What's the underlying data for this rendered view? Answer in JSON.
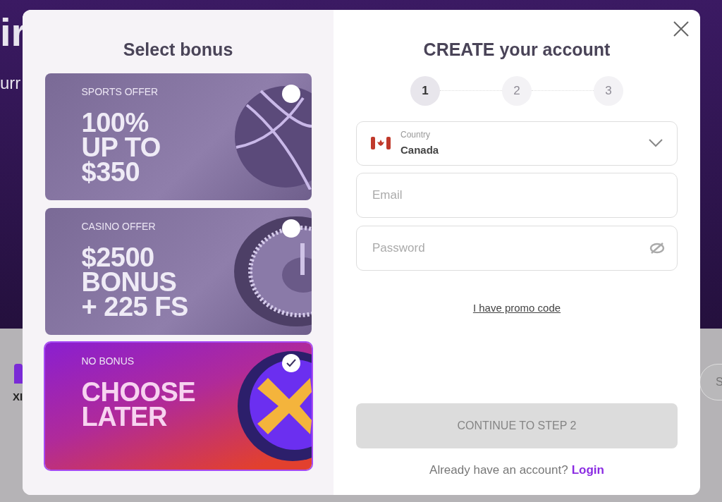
{
  "background": {
    "hero_fragments": [
      "ir",
      "urr"
    ],
    "tile_fragment": "XI",
    "pill_fragment": "S"
  },
  "bonus_panel": {
    "title": "Select bonus",
    "offers": [
      {
        "kind": "sports",
        "category": "SPORTS OFFER",
        "headline": [
          "100%",
          "UP TO",
          "$350"
        ],
        "selected": false
      },
      {
        "kind": "casino",
        "category": "CASINO OFFER",
        "headline": [
          "$2500",
          "BONUS",
          "+ 225 FS"
        ],
        "selected": false
      },
      {
        "kind": "none",
        "category": "NO BONUS",
        "headline": [
          "CHOOSE",
          "LATER"
        ],
        "selected": true
      }
    ]
  },
  "account_panel": {
    "title": "CREATE your account",
    "steps": [
      {
        "label": "1",
        "selected": true
      },
      {
        "label": "2",
        "selected": false
      },
      {
        "label": "3",
        "selected": false
      }
    ],
    "country": {
      "label": "Country",
      "value": "Canada"
    },
    "email": {
      "placeholder": "Email"
    },
    "password": {
      "placeholder": "Password"
    },
    "promo_link": "I have promo code",
    "continue_button": {
      "label": "CONTINUE TO STEP 2",
      "disabled": true
    },
    "login_prompt": "Already have an account?",
    "login_link": "Login"
  }
}
